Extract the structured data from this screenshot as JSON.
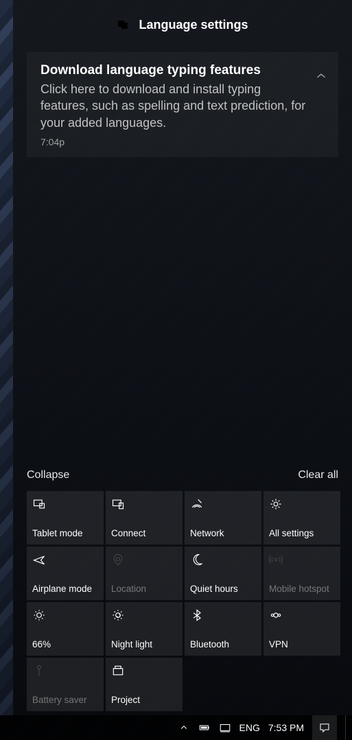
{
  "header": {
    "title": "Language settings"
  },
  "notification": {
    "title": "Download language typing features",
    "body": "Click here to download and install typing features, such as spelling and text prediction, for your added languages.",
    "time": "7:04p"
  },
  "links": {
    "collapse": "Collapse",
    "clear_all": "Clear all"
  },
  "tiles": [
    {
      "id": "tablet-mode",
      "label": "Tablet mode",
      "icon": "tablet",
      "dim": false
    },
    {
      "id": "connect",
      "label": "Connect",
      "icon": "connect",
      "dim": false
    },
    {
      "id": "network",
      "label": "Network",
      "icon": "network",
      "dim": false
    },
    {
      "id": "all-settings",
      "label": "All settings",
      "icon": "settings",
      "dim": false
    },
    {
      "id": "airplane-mode",
      "label": "Airplane mode",
      "icon": "airplane",
      "dim": false
    },
    {
      "id": "location",
      "label": "Location",
      "icon": "location",
      "dim": true
    },
    {
      "id": "quiet-hours",
      "label": "Quiet hours",
      "icon": "moon",
      "dim": false
    },
    {
      "id": "mobile-hotspot",
      "label": "Mobile hotspot",
      "icon": "hotspot",
      "dim": true
    },
    {
      "id": "brightness",
      "label": "66%",
      "icon": "sun",
      "dim": false
    },
    {
      "id": "night-light",
      "label": "Night light",
      "icon": "nightlight",
      "dim": false
    },
    {
      "id": "bluetooth",
      "label": "Bluetooth",
      "icon": "bluetooth",
      "dim": false
    },
    {
      "id": "vpn",
      "label": "VPN",
      "icon": "vpn",
      "dim": false
    },
    {
      "id": "battery-saver",
      "label": "Battery saver",
      "icon": "battery",
      "dim": true
    },
    {
      "id": "project",
      "label": "Project",
      "icon": "project",
      "dim": false
    }
  ],
  "taskbar": {
    "language": "ENG",
    "clock": "7:53 PM"
  }
}
